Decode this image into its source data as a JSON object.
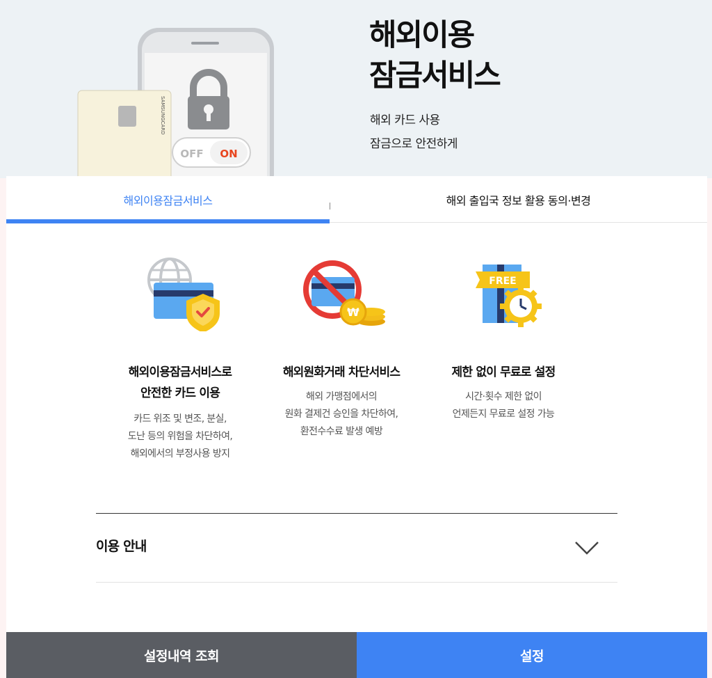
{
  "hero": {
    "title_line1": "해외이용",
    "title_line2": "잠금서비스",
    "sub_line1": "해외 카드 사용",
    "sub_line2": "잠금으로 안전하게",
    "toggle_off": "OFF",
    "toggle_on": "ON",
    "card_brand": "SAMSUNGCARD"
  },
  "tabs": [
    {
      "label": "해외이용잠금서비스",
      "active": true
    },
    {
      "label": "해외 출입국 정보 활용 동의·변경",
      "active": false
    }
  ],
  "features": [
    {
      "icon": "globe-card-shield-icon",
      "title_line1": "해외이용잠금서비스로",
      "title_line2": "안전한 카드 이용",
      "desc_line1": "카드 위조 및 변조, 분실,",
      "desc_line2": "도난 등의 위험을 차단하여,",
      "desc_line3": "해외에서의 부정사용 방지"
    },
    {
      "icon": "blocked-card-won-icon",
      "title_line1": "해외원화거래 차단서비스",
      "desc_line1": "해외 가맹점에서의",
      "desc_line2": "원화 결제건 승인을 차단하여,",
      "desc_line3": "환전수수료 발생 예방"
    },
    {
      "icon": "free-gift-clock-icon",
      "badge": "FREE",
      "title_line1": "제한 없이 무료로 설정",
      "desc_line1": "시간·횟수 제한 없이",
      "desc_line2": "언제든지 무료로 설정 가능"
    }
  ],
  "guide": {
    "label": "이용 안내"
  },
  "buttons": {
    "history": "설정내역 조회",
    "setting": "설정"
  },
  "colors": {
    "accent": "#3e83f3",
    "dark_button": "#5a5d63",
    "hero_bg": "#edf2f5"
  }
}
